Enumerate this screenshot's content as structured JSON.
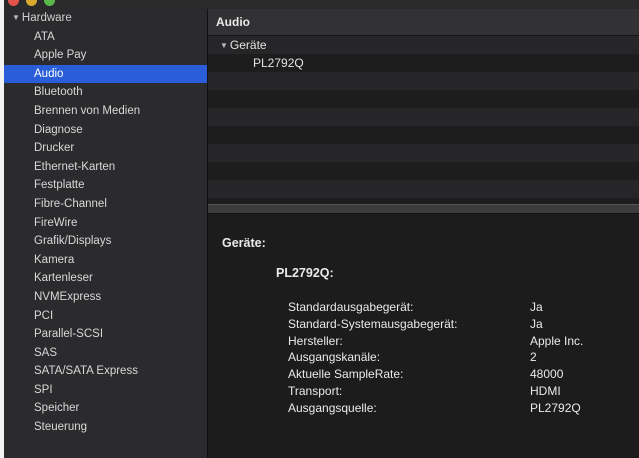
{
  "sidebar": {
    "group_label": "Hardware",
    "items": [
      {
        "label": "ATA",
        "selected": false
      },
      {
        "label": "Apple Pay",
        "selected": false
      },
      {
        "label": "Audio",
        "selected": true
      },
      {
        "label": "Bluetooth",
        "selected": false
      },
      {
        "label": "Brennen von Medien",
        "selected": false
      },
      {
        "label": "Diagnose",
        "selected": false
      },
      {
        "label": "Drucker",
        "selected": false
      },
      {
        "label": "Ethernet-Karten",
        "selected": false
      },
      {
        "label": "Festplatte",
        "selected": false
      },
      {
        "label": "Fibre-Channel",
        "selected": false
      },
      {
        "label": "FireWire",
        "selected": false
      },
      {
        "label": "Grafik/Displays",
        "selected": false
      },
      {
        "label": "Kamera",
        "selected": false
      },
      {
        "label": "Kartenleser",
        "selected": false
      },
      {
        "label": "NVMExpress",
        "selected": false
      },
      {
        "label": "PCI",
        "selected": false
      },
      {
        "label": "Parallel-SCSI",
        "selected": false
      },
      {
        "label": "SAS",
        "selected": false
      },
      {
        "label": "SATA/SATA Express",
        "selected": false
      },
      {
        "label": "SPI",
        "selected": false
      },
      {
        "label": "Speicher",
        "selected": false
      },
      {
        "label": "Steuerung",
        "selected": false
      }
    ]
  },
  "main": {
    "title": "Audio",
    "tree": {
      "group_label": "Geräte",
      "device_label": "PL2792Q"
    },
    "detail": {
      "heading": "Geräte:",
      "device": "PL2792Q:",
      "properties": [
        {
          "key": "Standardausgabegerät:",
          "value": "Ja"
        },
        {
          "key": "Standard-Systemausgabegerät:",
          "value": "Ja"
        },
        {
          "key": "Hersteller:",
          "value": "Apple Inc."
        },
        {
          "key": "Ausgangskanäle:",
          "value": "2"
        },
        {
          "key": "Aktuelle SampleRate:",
          "value": "48000"
        },
        {
          "key": "Transport:",
          "value": "HDMI"
        },
        {
          "key": "Ausgangsquelle:",
          "value": "PL2792Q"
        }
      ]
    }
  },
  "colors": {
    "selection": "#2a5ed8",
    "sidebar_bg": "#2b2b2d",
    "content_bg": "#1e1e1e"
  }
}
